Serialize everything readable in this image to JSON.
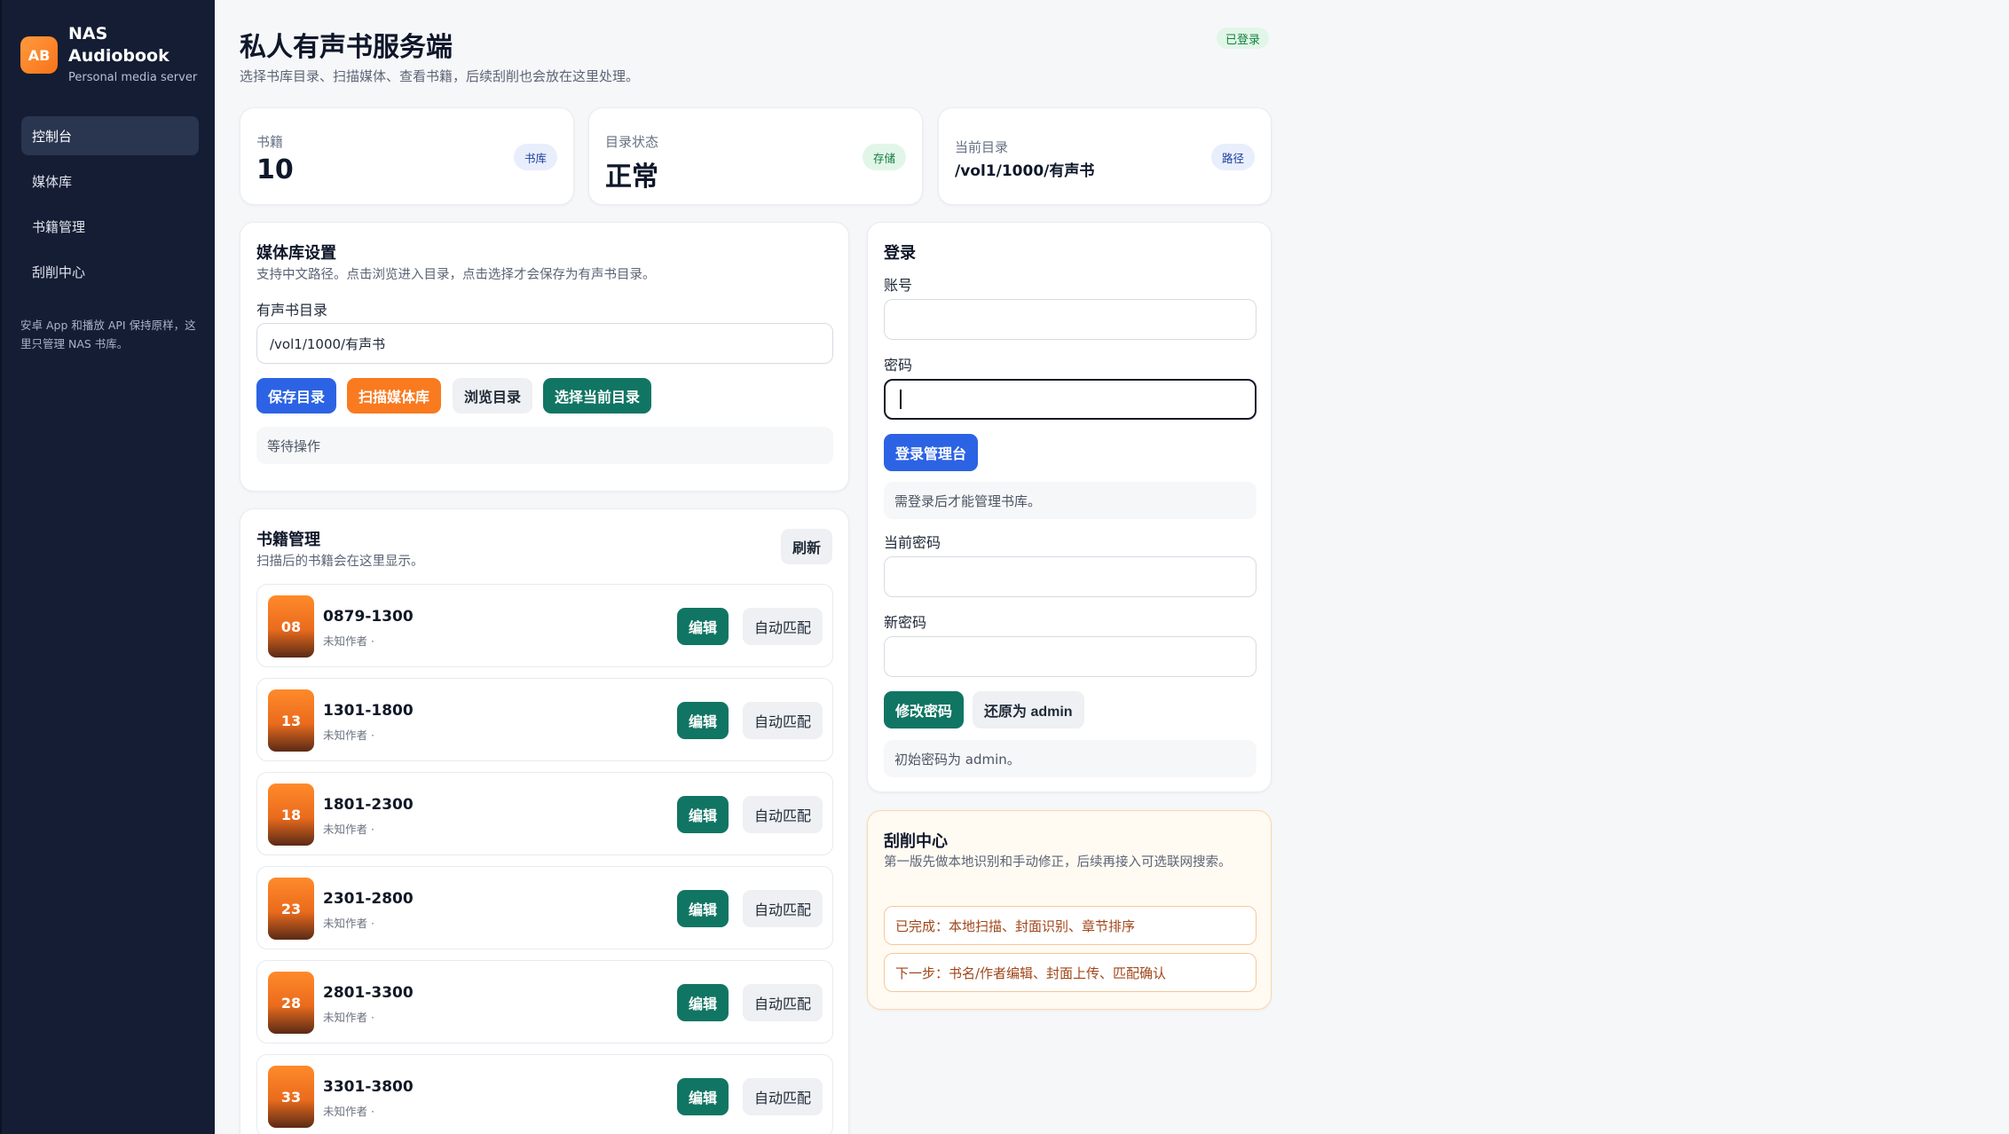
{
  "brand": {
    "logo_text": "AB",
    "name_line1": "NAS",
    "name_line2": "Audiobook",
    "subtitle": "Personal media server"
  },
  "nav": {
    "items": [
      {
        "label": "控制台",
        "active": true
      },
      {
        "label": "媒体库",
        "active": false
      },
      {
        "label": "书籍管理",
        "active": false
      },
      {
        "label": "刮削中心",
        "active": false
      }
    ],
    "note": "安卓 App 和播放 API 保持原样，这里只管理 NAS 书库。"
  },
  "header": {
    "title": "私人有声书服务端",
    "subtitle": "选择书库目录、扫描媒体、查看书籍，后续刮削也会放在这里处理。",
    "login_badge": "已登录"
  },
  "stats": [
    {
      "label": "书籍",
      "value": "10",
      "pill": "书库"
    },
    {
      "label": "目录状态",
      "value": "正常",
      "pill": "存储"
    },
    {
      "label": "当前目录",
      "value": "/vol1/1000/有声书",
      "pill": "路径"
    }
  ],
  "library": {
    "title": "媒体库设置",
    "subtitle": "支持中文路径。点击浏览进入目录，点击选择才会保存为有声书目录。",
    "dir_label": "有声书目录",
    "dir_value": "/vol1/1000/有声书",
    "btn_save": "保存目录",
    "btn_scan": "扫描媒体库",
    "btn_browse": "浏览目录",
    "btn_select": "选择当前目录",
    "status": "等待操作"
  },
  "books": {
    "title": "书籍管理",
    "subtitle": "扫描后的书籍会在这里显示。",
    "refresh": "刷新",
    "edit_label": "编辑",
    "match_label": "自动匹配",
    "items": [
      {
        "cover": "08",
        "title": "0879-1300",
        "meta": "未知作者 ·"
      },
      {
        "cover": "13",
        "title": "1301-1800",
        "meta": "未知作者 ·"
      },
      {
        "cover": "18",
        "title": "1801-2300",
        "meta": "未知作者 ·"
      },
      {
        "cover": "23",
        "title": "2301-2800",
        "meta": "未知作者 ·"
      },
      {
        "cover": "28",
        "title": "2801-3300",
        "meta": "未知作者 ·"
      },
      {
        "cover": "33",
        "title": "3301-3800",
        "meta": "未知作者 ·"
      }
    ]
  },
  "login": {
    "title": "登录",
    "account_label": "账号",
    "account_value": "",
    "password_label": "密码",
    "password_value": "",
    "btn_login": "登录管理台",
    "status": "需登录后才能管理书库。",
    "current_pw_label": "当前密码",
    "new_pw_label": "新密码",
    "btn_change": "修改密码",
    "btn_reset": "还原为 admin",
    "hint": "初始密码为 admin。"
  },
  "scrape": {
    "title": "刮削中心",
    "subtitle": "第一版先做本地识别和手动修正，后续再接入可选联网搜索。",
    "done": "已完成：本地扫描、封面识别、章节排序",
    "next": "下一步：书名/作者编辑、封面上传、匹配确认"
  }
}
